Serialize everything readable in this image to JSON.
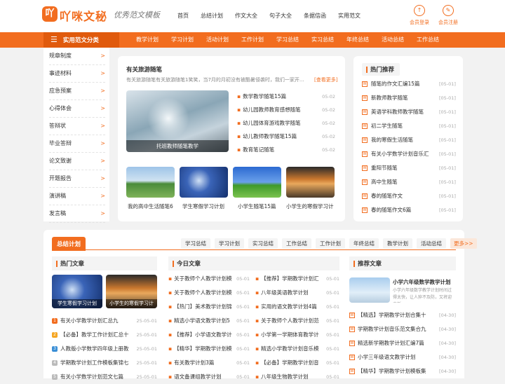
{
  "header": {
    "logo_glyph": "吖",
    "logo_text": "吖咪文秘",
    "slogan": "优秀范文模板",
    "nav": [
      "首页",
      "总结计划",
      "作文大全",
      "句子大全",
      "条据信函",
      "实用范文"
    ],
    "login": "会员登录",
    "register": "会员注册"
  },
  "catbar": {
    "title": "实用范文分类",
    "links": [
      "教学计划",
      "学习计划",
      "活动计划",
      "工作计划",
      "学习总结",
      "实习总结",
      "年终总结",
      "活动总结",
      "工作总结"
    ]
  },
  "sidebar": [
    "规章制度",
    "事迹材料",
    "应急预案",
    "心得体会",
    "答辩状",
    "毕业答辩",
    "论文致谢",
    "开题报告",
    "演讲稿",
    "发言稿"
  ],
  "featured": {
    "title": "有关旅游随笔",
    "desc": "有关旅游随笔有关旅游随笔1笑笑，当7月的月初没有被酷暑侵袭时，我们一家开...",
    "more": "[查看更多]",
    "big_caption": "托班教师随笔教学",
    "list": [
      {
        "text": "数学教学随笔15篇",
        "date": "05-02"
      },
      {
        "text": "幼儿园教师教育感想随笔",
        "date": "05-02"
      },
      {
        "text": "幼儿园体育游戏教学随笔",
        "date": "05-02"
      },
      {
        "text": "幼儿教师教学随笔15篇",
        "date": "05-02"
      },
      {
        "text": "教育笔记随笔",
        "date": "05-02"
      }
    ],
    "thumbs": [
      "我的高中生活随笔6",
      "学生寒假学习计划",
      "小学生随笔15篇",
      "小学生的寒假学习计"
    ]
  },
  "hot": {
    "title": "热门推荐",
    "items": [
      {
        "text": "随笔的作文汇编15篇",
        "date": "[05-01]"
      },
      {
        "text": "新教师教学随笔",
        "date": "[05-01]"
      },
      {
        "text": "英语学科教师教学随笔",
        "date": "[05-01]"
      },
      {
        "text": "初二学生随笔",
        "date": "[05-01]"
      },
      {
        "text": "我的寒假生活随笔",
        "date": "[05-01]"
      },
      {
        "text": "有关小学数学计划音乐汇",
        "date": "[05-01]"
      },
      {
        "text": "重阳节随笔",
        "date": "[05-01]"
      },
      {
        "text": "高中生随笔",
        "date": "[05-01]"
      },
      {
        "text": "春的随笔作文",
        "date": "[05-01]"
      },
      {
        "text": "春的随笔作文6篇",
        "date": "[05-01]"
      }
    ]
  },
  "summary": {
    "title": "总结计划",
    "tabs": [
      "学习总结",
      "学习计划",
      "实习总结",
      "工作总结",
      "工作计划",
      "年终总结",
      "教学计划",
      "活动总结"
    ],
    "more": "更多>>",
    "hot_title": "热门文章",
    "hot_thumbs": [
      "学生寒假学习计划",
      "小学生的寒假学习计"
    ],
    "hot_list": [
      {
        "text": "有关小学教学计划汇总九",
        "date": "25-05-01"
      },
      {
        "text": "【必备】教学工作计划汇总十",
        "date": "25-05-01"
      },
      {
        "text": "人教版小学数学四年级上册教",
        "date": "25-05-01"
      },
      {
        "text": "学期教学计划工作模板集锦七",
        "date": "25-05-01"
      },
      {
        "text": "有关小学数学计划范文七篇",
        "date": "25-05-01"
      }
    ],
    "today_title": "今日文章",
    "today_left": [
      {
        "text": "关于教师个人教学计划模",
        "date": "05-01"
      },
      {
        "text": "关于教师个人教学计划模",
        "date": "05-01"
      },
      {
        "text": "【热门】美术教学计划锦",
        "date": "05-01"
      },
      {
        "text": "精选小学语文教学计划5",
        "date": "05-01"
      },
      {
        "text": "【推荐】小学语文教学计",
        "date": "05-01"
      },
      {
        "text": "【精华】学期教学计划模",
        "date": "05-01"
      },
      {
        "text": "有关教学计划3篇",
        "date": "05-01"
      },
      {
        "text": "语文备课组教学计划",
        "date": "05-01"
      }
    ],
    "today_right": [
      {
        "text": "【推荐】学期教学计划汇",
        "date": "05-01"
      },
      {
        "text": "八年级英语教学计划",
        "date": "05-01"
      },
      {
        "text": "实用的语文教学计划4篇",
        "date": "05-01"
      },
      {
        "text": "关于教师个人教学计划范",
        "date": "05-01"
      },
      {
        "text": "小学第一学期体育教学计",
        "date": "05-01"
      },
      {
        "text": "精选小学教学计划音乐模",
        "date": "05-01"
      },
      {
        "text": "【必备】学期教学计划音",
        "date": "05-01"
      },
      {
        "text": "八年级生物教学计划",
        "date": "05-01"
      }
    ],
    "rec_title": "推荐文章",
    "rec_top_title": "小学六年级数学教学计划",
    "rec_top_desc": "小学六年级数学教学计划时间过得太快，让人猝不及防，又将迎来新",
    "rec_list": [
      {
        "text": "【精选】学期教学计划合集十",
        "date": "[04-30]"
      },
      {
        "text": "学期教学计划音乐范文集合九",
        "date": "[04-30]"
      },
      {
        "text": "精选新学期教学计划汇编7篇",
        "date": "[04-30]"
      },
      {
        "text": "小学三年级语文教学计划",
        "date": "[04-30]"
      },
      {
        "text": "【精华】学期教学计划模板集",
        "date": "[04-30]"
      }
    ]
  },
  "colors": {
    "brand": "#f26d1f",
    "rank1": "#f26d1f",
    "rank2": "#f5a623",
    "rank3": "#3a8fd6",
    "rank_other": "#bbbbbb"
  }
}
